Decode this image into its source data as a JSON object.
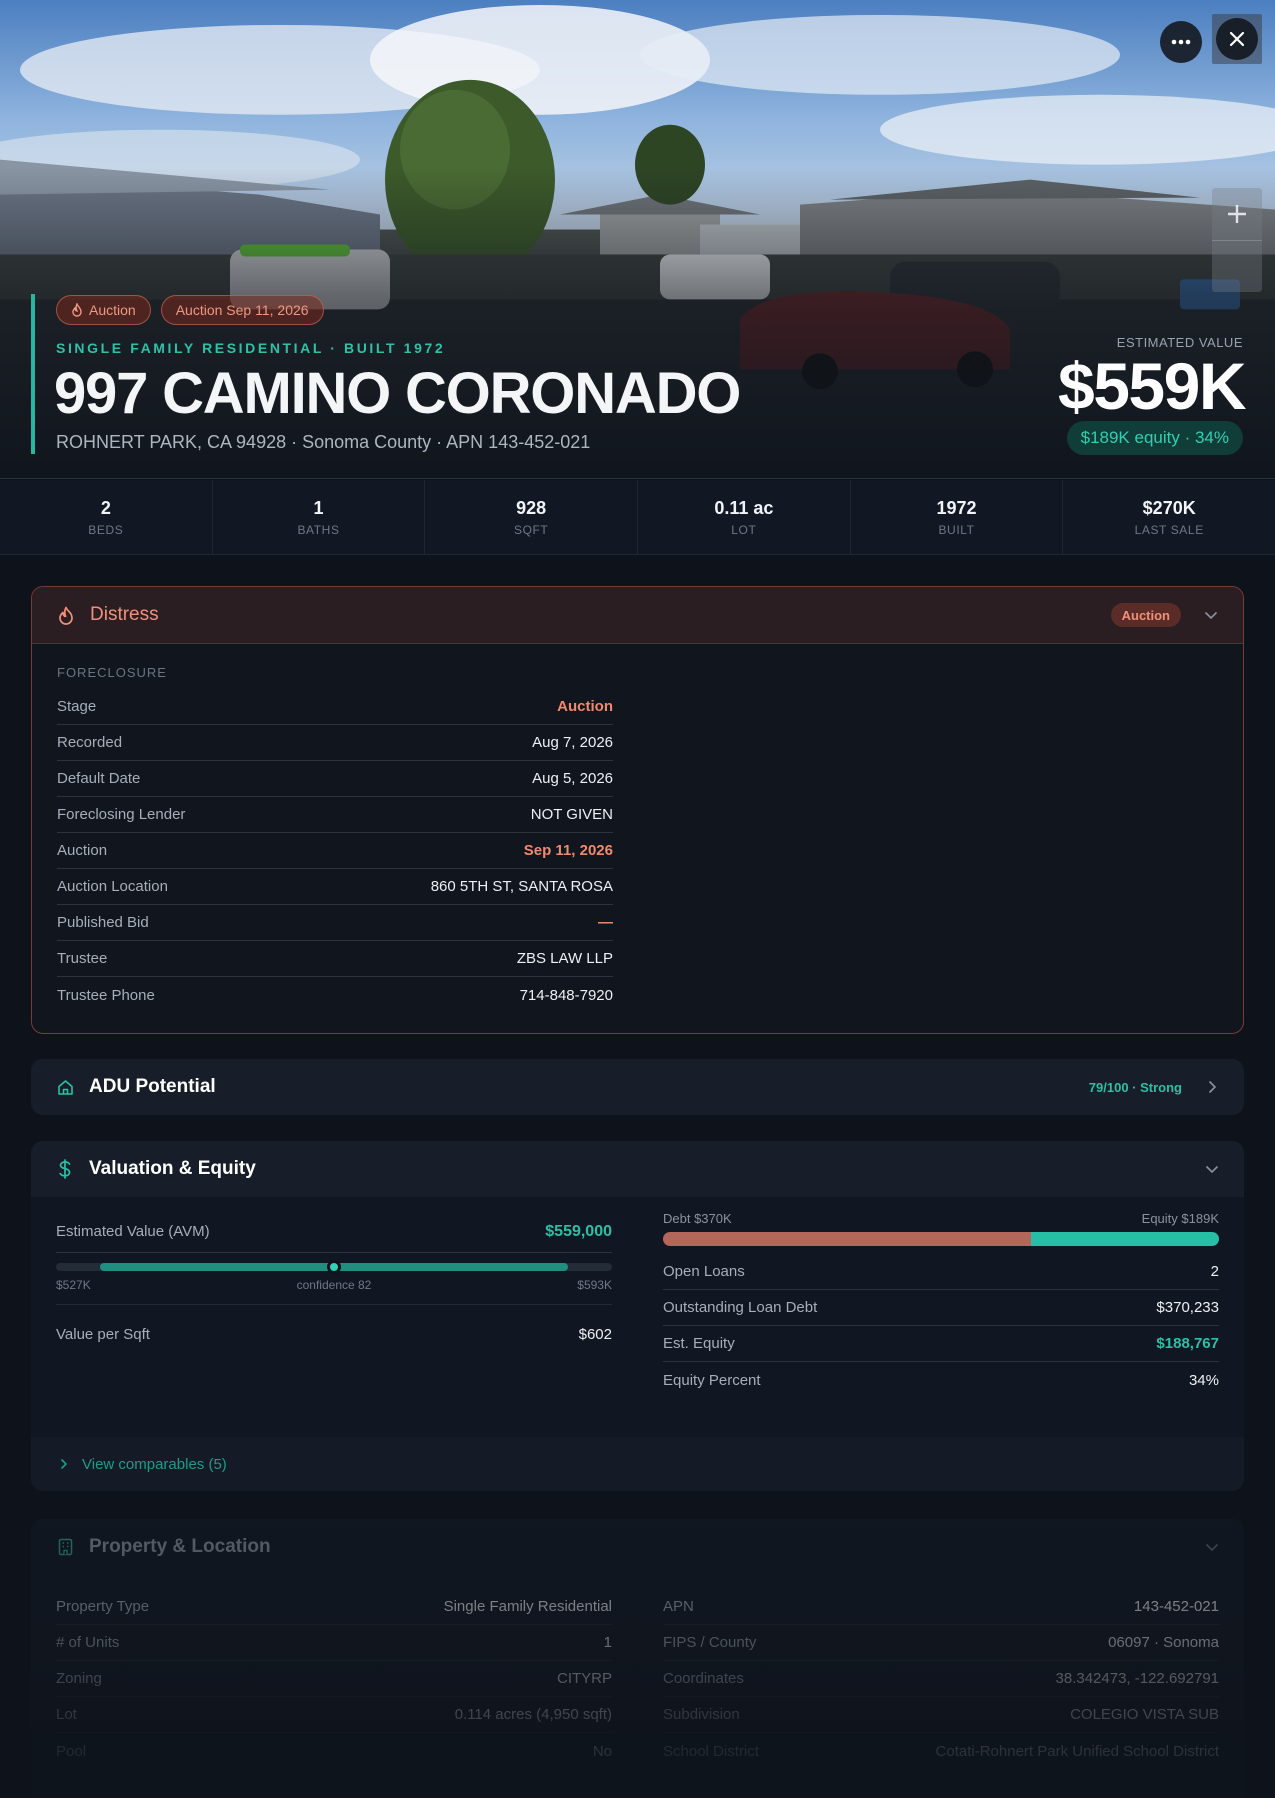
{
  "hero": {
    "more_icon": "more-horizontal-icon",
    "close_icon": "close-icon",
    "zoom_in_icon": "plus-icon",
    "chips": [
      {
        "icon": "flame-icon",
        "label": "Auction"
      },
      {
        "label": "Auction Sep 11, 2026"
      }
    ],
    "subtitle": "SINGLE FAMILY RESIDENTIAL · BUILT 1972",
    "address": "997 CAMINO CORONADO",
    "locality": "ROHNERT PARK, CA 94928 · Sonoma County · APN 143-452-021",
    "est_label": "ESTIMATED VALUE",
    "est_value": "$559K",
    "equity_pill": "$189K equity · 34%"
  },
  "stats": [
    {
      "value": "2",
      "label": "BEDS"
    },
    {
      "value": "1",
      "label": "BATHS"
    },
    {
      "value": "928",
      "label": "SQFT"
    },
    {
      "value": "0.11 ac",
      "label": "LOT"
    },
    {
      "value": "1972",
      "label": "BUILT"
    },
    {
      "value": "$270K",
      "label": "LAST SALE"
    }
  ],
  "distress": {
    "icon": "flame-icon",
    "title": "Distress",
    "badge": "Auction",
    "section_label": "FORECLOSURE",
    "rows": [
      {
        "k": "Stage",
        "v": "Auction",
        "hot": true
      },
      {
        "k": "Recorded",
        "v": "Aug 7, 2026"
      },
      {
        "k": "Default Date",
        "v": "Aug 5, 2026"
      },
      {
        "k": "Foreclosing Lender",
        "v": "NOT GIVEN"
      },
      {
        "k": "Auction",
        "v": "Sep 11, 2026",
        "hot": true
      },
      {
        "k": "Auction Location",
        "v": "860 5TH ST, SANTA ROSA"
      },
      {
        "k": "Published Bid",
        "v": "—",
        "hot": true
      },
      {
        "k": "Trustee",
        "v": "ZBS LAW LLP"
      },
      {
        "k": "Trustee Phone",
        "v": "714-848-7920"
      }
    ]
  },
  "adu": {
    "icon": "home-icon",
    "title": "ADU Potential",
    "score": "79/100 · Strong"
  },
  "valuation": {
    "icon": "dollar-icon",
    "title": "Valuation & Equity",
    "avm_label": "Estimated Value (AVM)",
    "avm_value": "$559,000",
    "range_low": "$527K",
    "range_high": "$593K",
    "confidence": "confidence 82",
    "range_fill_start": 0.08,
    "range_fill_end": 0.92,
    "range_point": 0.5,
    "value_per_sqft_label": "Value per Sqft",
    "value_per_sqft": "$602",
    "debt_label": "Debt $370K",
    "equity_label": "Equity $189K",
    "debt_fraction": 0.662,
    "rows": [
      {
        "k": "Open Loans",
        "v": "2"
      },
      {
        "k": "Outstanding Loan Debt",
        "v": "$370,233"
      },
      {
        "k": "Est. Equity",
        "v": "$188,767",
        "green": true
      },
      {
        "k": "Equity Percent",
        "v": "34%"
      }
    ],
    "comparables": "View comparables (5)"
  },
  "property": {
    "icon": "building-icon",
    "title": "Property & Location",
    "left": [
      {
        "k": "Property Type",
        "v": "Single Family Residential"
      },
      {
        "k": "# of Units",
        "v": "1"
      },
      {
        "k": "Zoning",
        "v": "CITYRP"
      },
      {
        "k": "Lot",
        "v": "0.114 acres (4,950 sqft)"
      },
      {
        "k": "Pool",
        "v": "No"
      }
    ],
    "right": [
      {
        "k": "APN",
        "v": "143-452-021"
      },
      {
        "k": "FIPS / County",
        "v": "06097 · Sonoma"
      },
      {
        "k": "Coordinates",
        "v": "38.342473, -122.692791"
      },
      {
        "k": "Subdivision",
        "v": "COLEGIO VISTA SUB"
      },
      {
        "k": "School District",
        "v": "Cotati-Rohnert Park Unified School District"
      }
    ]
  },
  "colors": {
    "accent": "#2bc0a6",
    "distress": "#f08a6c",
    "debt": "#b5665a",
    "equity": "#26bfa6"
  }
}
